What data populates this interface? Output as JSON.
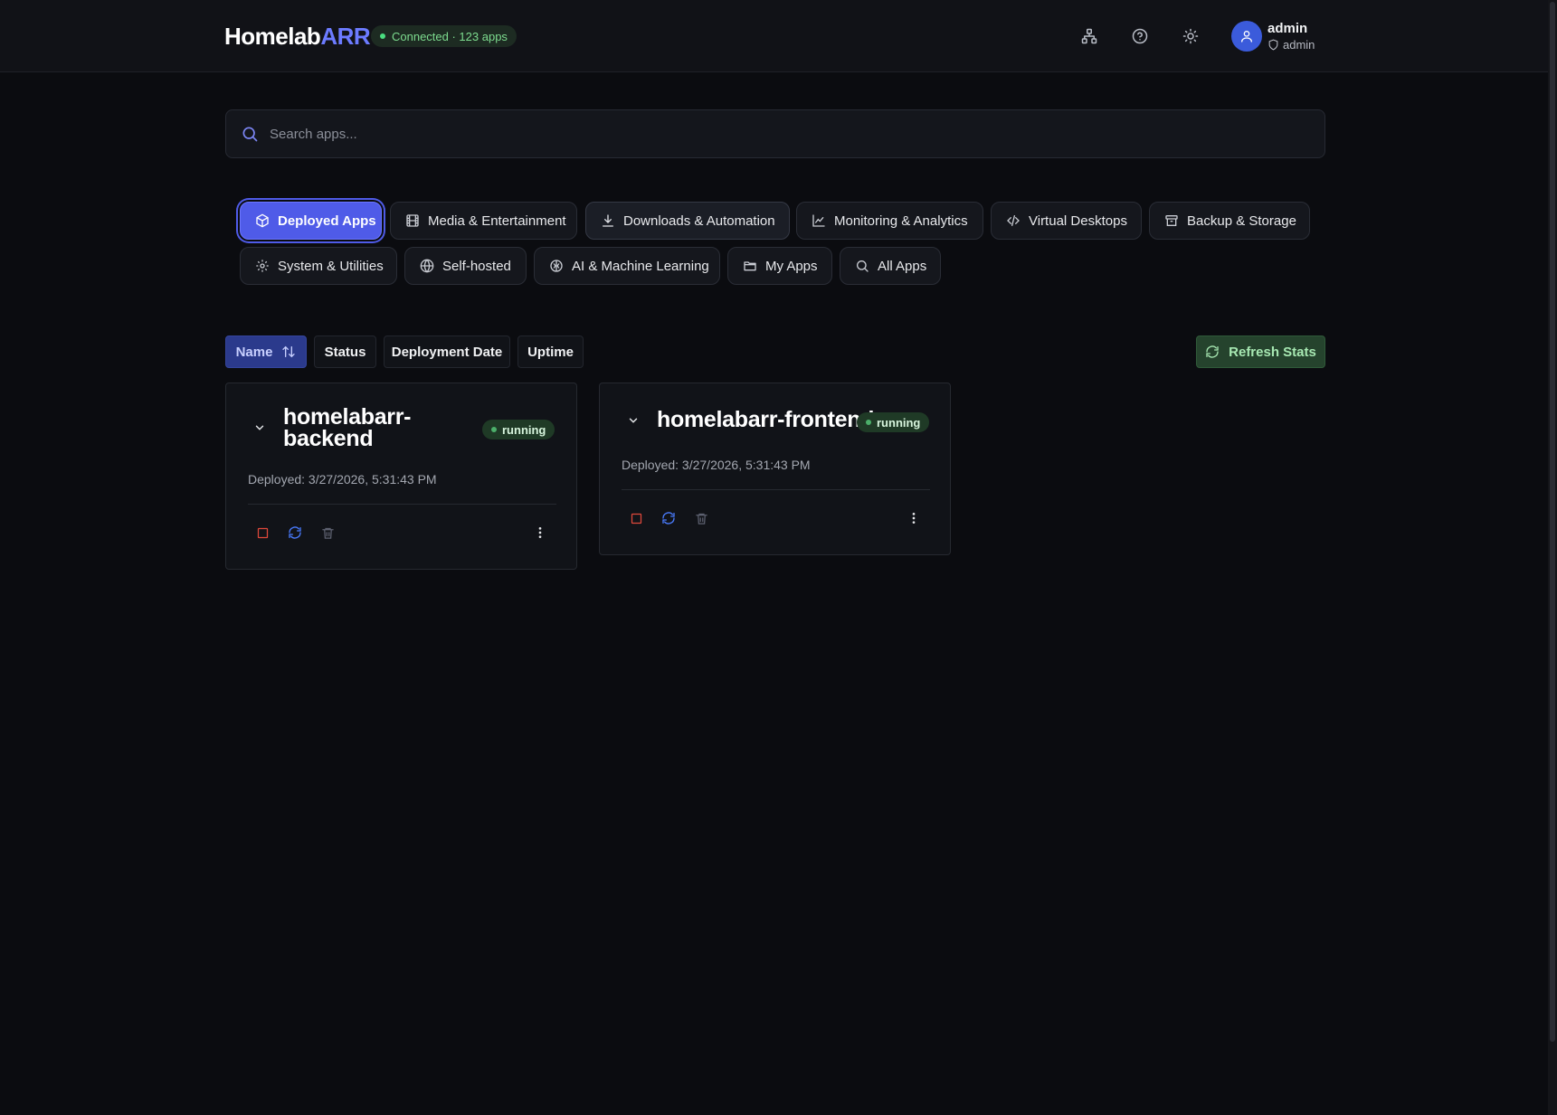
{
  "header": {
    "logo_main": "Homelab",
    "logo_accent": "ARR",
    "connection": "Connected · 123 apps",
    "user": {
      "name": "admin",
      "role": "admin"
    }
  },
  "search": {
    "placeholder": "Search apps..."
  },
  "tabs": [
    {
      "label": "Deployed Apps",
      "icon": "box-icon"
    },
    {
      "label": "Media & Entertainment",
      "icon": "film-icon"
    },
    {
      "label": "Downloads & Automation",
      "icon": "download-icon"
    },
    {
      "label": "Monitoring & Analytics",
      "icon": "chart-line-icon"
    },
    {
      "label": "Virtual Desktops",
      "icon": "code-icon"
    },
    {
      "label": "Backup & Storage",
      "icon": "archive-icon"
    },
    {
      "label": "System & Utilities",
      "icon": "gear-icon"
    },
    {
      "label": "Self-hosted",
      "icon": "globe-icon"
    },
    {
      "label": "AI & Machine Learning",
      "icon": "brain-icon"
    },
    {
      "label": "My Apps",
      "icon": "folder-icon"
    },
    {
      "label": "All Apps",
      "icon": "search-icon"
    }
  ],
  "sort": {
    "options": [
      "Name",
      "Status",
      "Deployment Date",
      "Uptime"
    ],
    "active": "Name",
    "refresh_label": "Refresh Stats"
  },
  "apps": [
    {
      "name_line1": "homelabarr-",
      "name_line2": "backend",
      "status": "running",
      "deployed": "Deployed: 3/27/2026, 5:31:43 PM"
    },
    {
      "name": "homelabarr-frontend",
      "status": "running",
      "deployed": "Deployed: 3/27/2026, 5:31:43 PM"
    }
  ],
  "colors": {
    "accent": "#4f5be8",
    "logo_accent": "#6c7bff",
    "running": "#4caf6a",
    "stop": "#e0483b",
    "restart": "#4a7cff",
    "background": "#0b0c10"
  }
}
